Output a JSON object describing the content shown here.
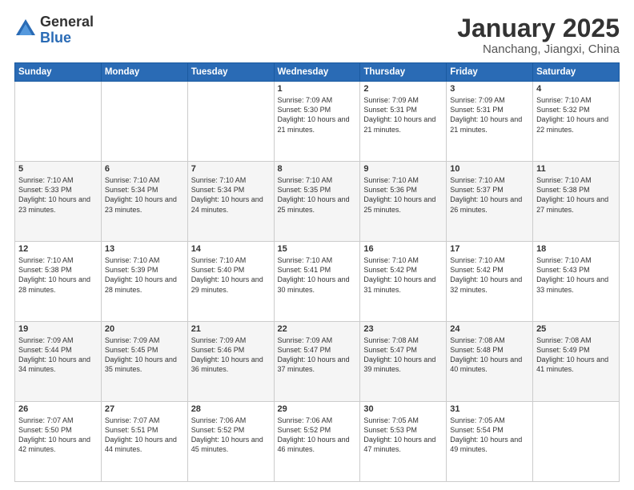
{
  "logo": {
    "general": "General",
    "blue": "Blue"
  },
  "title": "January 2025",
  "subtitle": "Nanchang, Jiangxi, China",
  "headers": [
    "Sunday",
    "Monday",
    "Tuesday",
    "Wednesday",
    "Thursday",
    "Friday",
    "Saturday"
  ],
  "weeks": [
    [
      {
        "day": "",
        "sunrise": "",
        "sunset": "",
        "daylight": ""
      },
      {
        "day": "",
        "sunrise": "",
        "sunset": "",
        "daylight": ""
      },
      {
        "day": "",
        "sunrise": "",
        "sunset": "",
        "daylight": ""
      },
      {
        "day": "1",
        "sunrise": "Sunrise: 7:09 AM",
        "sunset": "Sunset: 5:30 PM",
        "daylight": "Daylight: 10 hours and 21 minutes."
      },
      {
        "day": "2",
        "sunrise": "Sunrise: 7:09 AM",
        "sunset": "Sunset: 5:31 PM",
        "daylight": "Daylight: 10 hours and 21 minutes."
      },
      {
        "day": "3",
        "sunrise": "Sunrise: 7:09 AM",
        "sunset": "Sunset: 5:31 PM",
        "daylight": "Daylight: 10 hours and 21 minutes."
      },
      {
        "day": "4",
        "sunrise": "Sunrise: 7:10 AM",
        "sunset": "Sunset: 5:32 PM",
        "daylight": "Daylight: 10 hours and 22 minutes."
      }
    ],
    [
      {
        "day": "5",
        "sunrise": "Sunrise: 7:10 AM",
        "sunset": "Sunset: 5:33 PM",
        "daylight": "Daylight: 10 hours and 23 minutes."
      },
      {
        "day": "6",
        "sunrise": "Sunrise: 7:10 AM",
        "sunset": "Sunset: 5:34 PM",
        "daylight": "Daylight: 10 hours and 23 minutes."
      },
      {
        "day": "7",
        "sunrise": "Sunrise: 7:10 AM",
        "sunset": "Sunset: 5:34 PM",
        "daylight": "Daylight: 10 hours and 24 minutes."
      },
      {
        "day": "8",
        "sunrise": "Sunrise: 7:10 AM",
        "sunset": "Sunset: 5:35 PM",
        "daylight": "Daylight: 10 hours and 25 minutes."
      },
      {
        "day": "9",
        "sunrise": "Sunrise: 7:10 AM",
        "sunset": "Sunset: 5:36 PM",
        "daylight": "Daylight: 10 hours and 25 minutes."
      },
      {
        "day": "10",
        "sunrise": "Sunrise: 7:10 AM",
        "sunset": "Sunset: 5:37 PM",
        "daylight": "Daylight: 10 hours and 26 minutes."
      },
      {
        "day": "11",
        "sunrise": "Sunrise: 7:10 AM",
        "sunset": "Sunset: 5:38 PM",
        "daylight": "Daylight: 10 hours and 27 minutes."
      }
    ],
    [
      {
        "day": "12",
        "sunrise": "Sunrise: 7:10 AM",
        "sunset": "Sunset: 5:38 PM",
        "daylight": "Daylight: 10 hours and 28 minutes."
      },
      {
        "day": "13",
        "sunrise": "Sunrise: 7:10 AM",
        "sunset": "Sunset: 5:39 PM",
        "daylight": "Daylight: 10 hours and 28 minutes."
      },
      {
        "day": "14",
        "sunrise": "Sunrise: 7:10 AM",
        "sunset": "Sunset: 5:40 PM",
        "daylight": "Daylight: 10 hours and 29 minutes."
      },
      {
        "day": "15",
        "sunrise": "Sunrise: 7:10 AM",
        "sunset": "Sunset: 5:41 PM",
        "daylight": "Daylight: 10 hours and 30 minutes."
      },
      {
        "day": "16",
        "sunrise": "Sunrise: 7:10 AM",
        "sunset": "Sunset: 5:42 PM",
        "daylight": "Daylight: 10 hours and 31 minutes."
      },
      {
        "day": "17",
        "sunrise": "Sunrise: 7:10 AM",
        "sunset": "Sunset: 5:42 PM",
        "daylight": "Daylight: 10 hours and 32 minutes."
      },
      {
        "day": "18",
        "sunrise": "Sunrise: 7:10 AM",
        "sunset": "Sunset: 5:43 PM",
        "daylight": "Daylight: 10 hours and 33 minutes."
      }
    ],
    [
      {
        "day": "19",
        "sunrise": "Sunrise: 7:09 AM",
        "sunset": "Sunset: 5:44 PM",
        "daylight": "Daylight: 10 hours and 34 minutes."
      },
      {
        "day": "20",
        "sunrise": "Sunrise: 7:09 AM",
        "sunset": "Sunset: 5:45 PM",
        "daylight": "Daylight: 10 hours and 35 minutes."
      },
      {
        "day": "21",
        "sunrise": "Sunrise: 7:09 AM",
        "sunset": "Sunset: 5:46 PM",
        "daylight": "Daylight: 10 hours and 36 minutes."
      },
      {
        "day": "22",
        "sunrise": "Sunrise: 7:09 AM",
        "sunset": "Sunset: 5:47 PM",
        "daylight": "Daylight: 10 hours and 37 minutes."
      },
      {
        "day": "23",
        "sunrise": "Sunrise: 7:08 AM",
        "sunset": "Sunset: 5:47 PM",
        "daylight": "Daylight: 10 hours and 39 minutes."
      },
      {
        "day": "24",
        "sunrise": "Sunrise: 7:08 AM",
        "sunset": "Sunset: 5:48 PM",
        "daylight": "Daylight: 10 hours and 40 minutes."
      },
      {
        "day": "25",
        "sunrise": "Sunrise: 7:08 AM",
        "sunset": "Sunset: 5:49 PM",
        "daylight": "Daylight: 10 hours and 41 minutes."
      }
    ],
    [
      {
        "day": "26",
        "sunrise": "Sunrise: 7:07 AM",
        "sunset": "Sunset: 5:50 PM",
        "daylight": "Daylight: 10 hours and 42 minutes."
      },
      {
        "day": "27",
        "sunrise": "Sunrise: 7:07 AM",
        "sunset": "Sunset: 5:51 PM",
        "daylight": "Daylight: 10 hours and 44 minutes."
      },
      {
        "day": "28",
        "sunrise": "Sunrise: 7:06 AM",
        "sunset": "Sunset: 5:52 PM",
        "daylight": "Daylight: 10 hours and 45 minutes."
      },
      {
        "day": "29",
        "sunrise": "Sunrise: 7:06 AM",
        "sunset": "Sunset: 5:52 PM",
        "daylight": "Daylight: 10 hours and 46 minutes."
      },
      {
        "day": "30",
        "sunrise": "Sunrise: 7:05 AM",
        "sunset": "Sunset: 5:53 PM",
        "daylight": "Daylight: 10 hours and 47 minutes."
      },
      {
        "day": "31",
        "sunrise": "Sunrise: 7:05 AM",
        "sunset": "Sunset: 5:54 PM",
        "daylight": "Daylight: 10 hours and 49 minutes."
      },
      {
        "day": "",
        "sunrise": "",
        "sunset": "",
        "daylight": ""
      }
    ]
  ]
}
